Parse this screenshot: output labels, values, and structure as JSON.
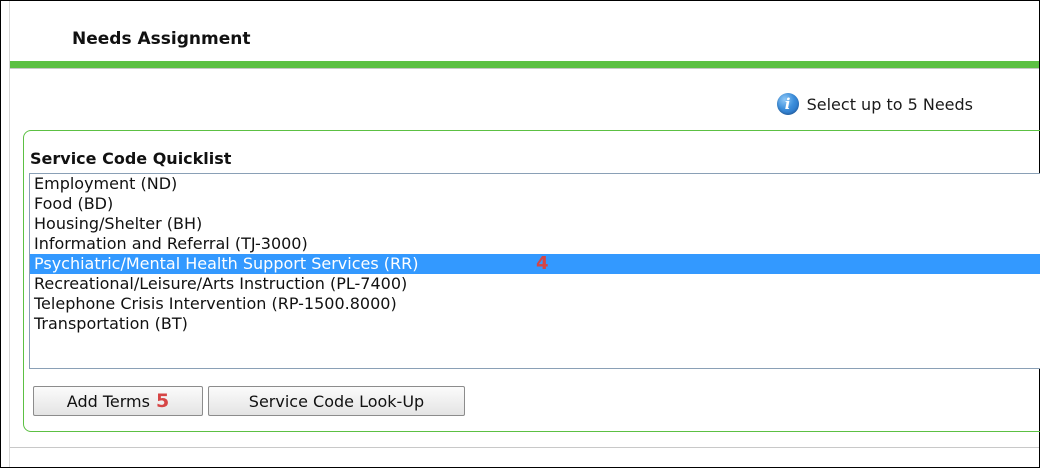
{
  "header": {
    "title": "Needs Assignment"
  },
  "info": {
    "icon": "info-icon",
    "text": "Select up to 5 Needs"
  },
  "quicklist": {
    "title": "Service Code Quicklist",
    "options": [
      "Employment (ND)",
      "Food (BD)",
      "Housing/Shelter (BH)",
      "Information and Referral (TJ-3000)",
      "Psychiatric/Mental Health Support Services (RR)",
      "Recreational/Leisure/Arts Instruction (PL-7400)",
      "Telephone Crisis Intervention (RP-1500.8000)",
      "Transportation (BT)"
    ],
    "selected_index": 4,
    "selected_marker": "4"
  },
  "buttons": {
    "add_terms": "Add Terms",
    "add_terms_marker": "5",
    "lookup": "Service Code Look-Up"
  },
  "colors": {
    "accent_green": "#5cc043",
    "selection_blue": "#3399ff",
    "marker_red": "#d64545"
  }
}
